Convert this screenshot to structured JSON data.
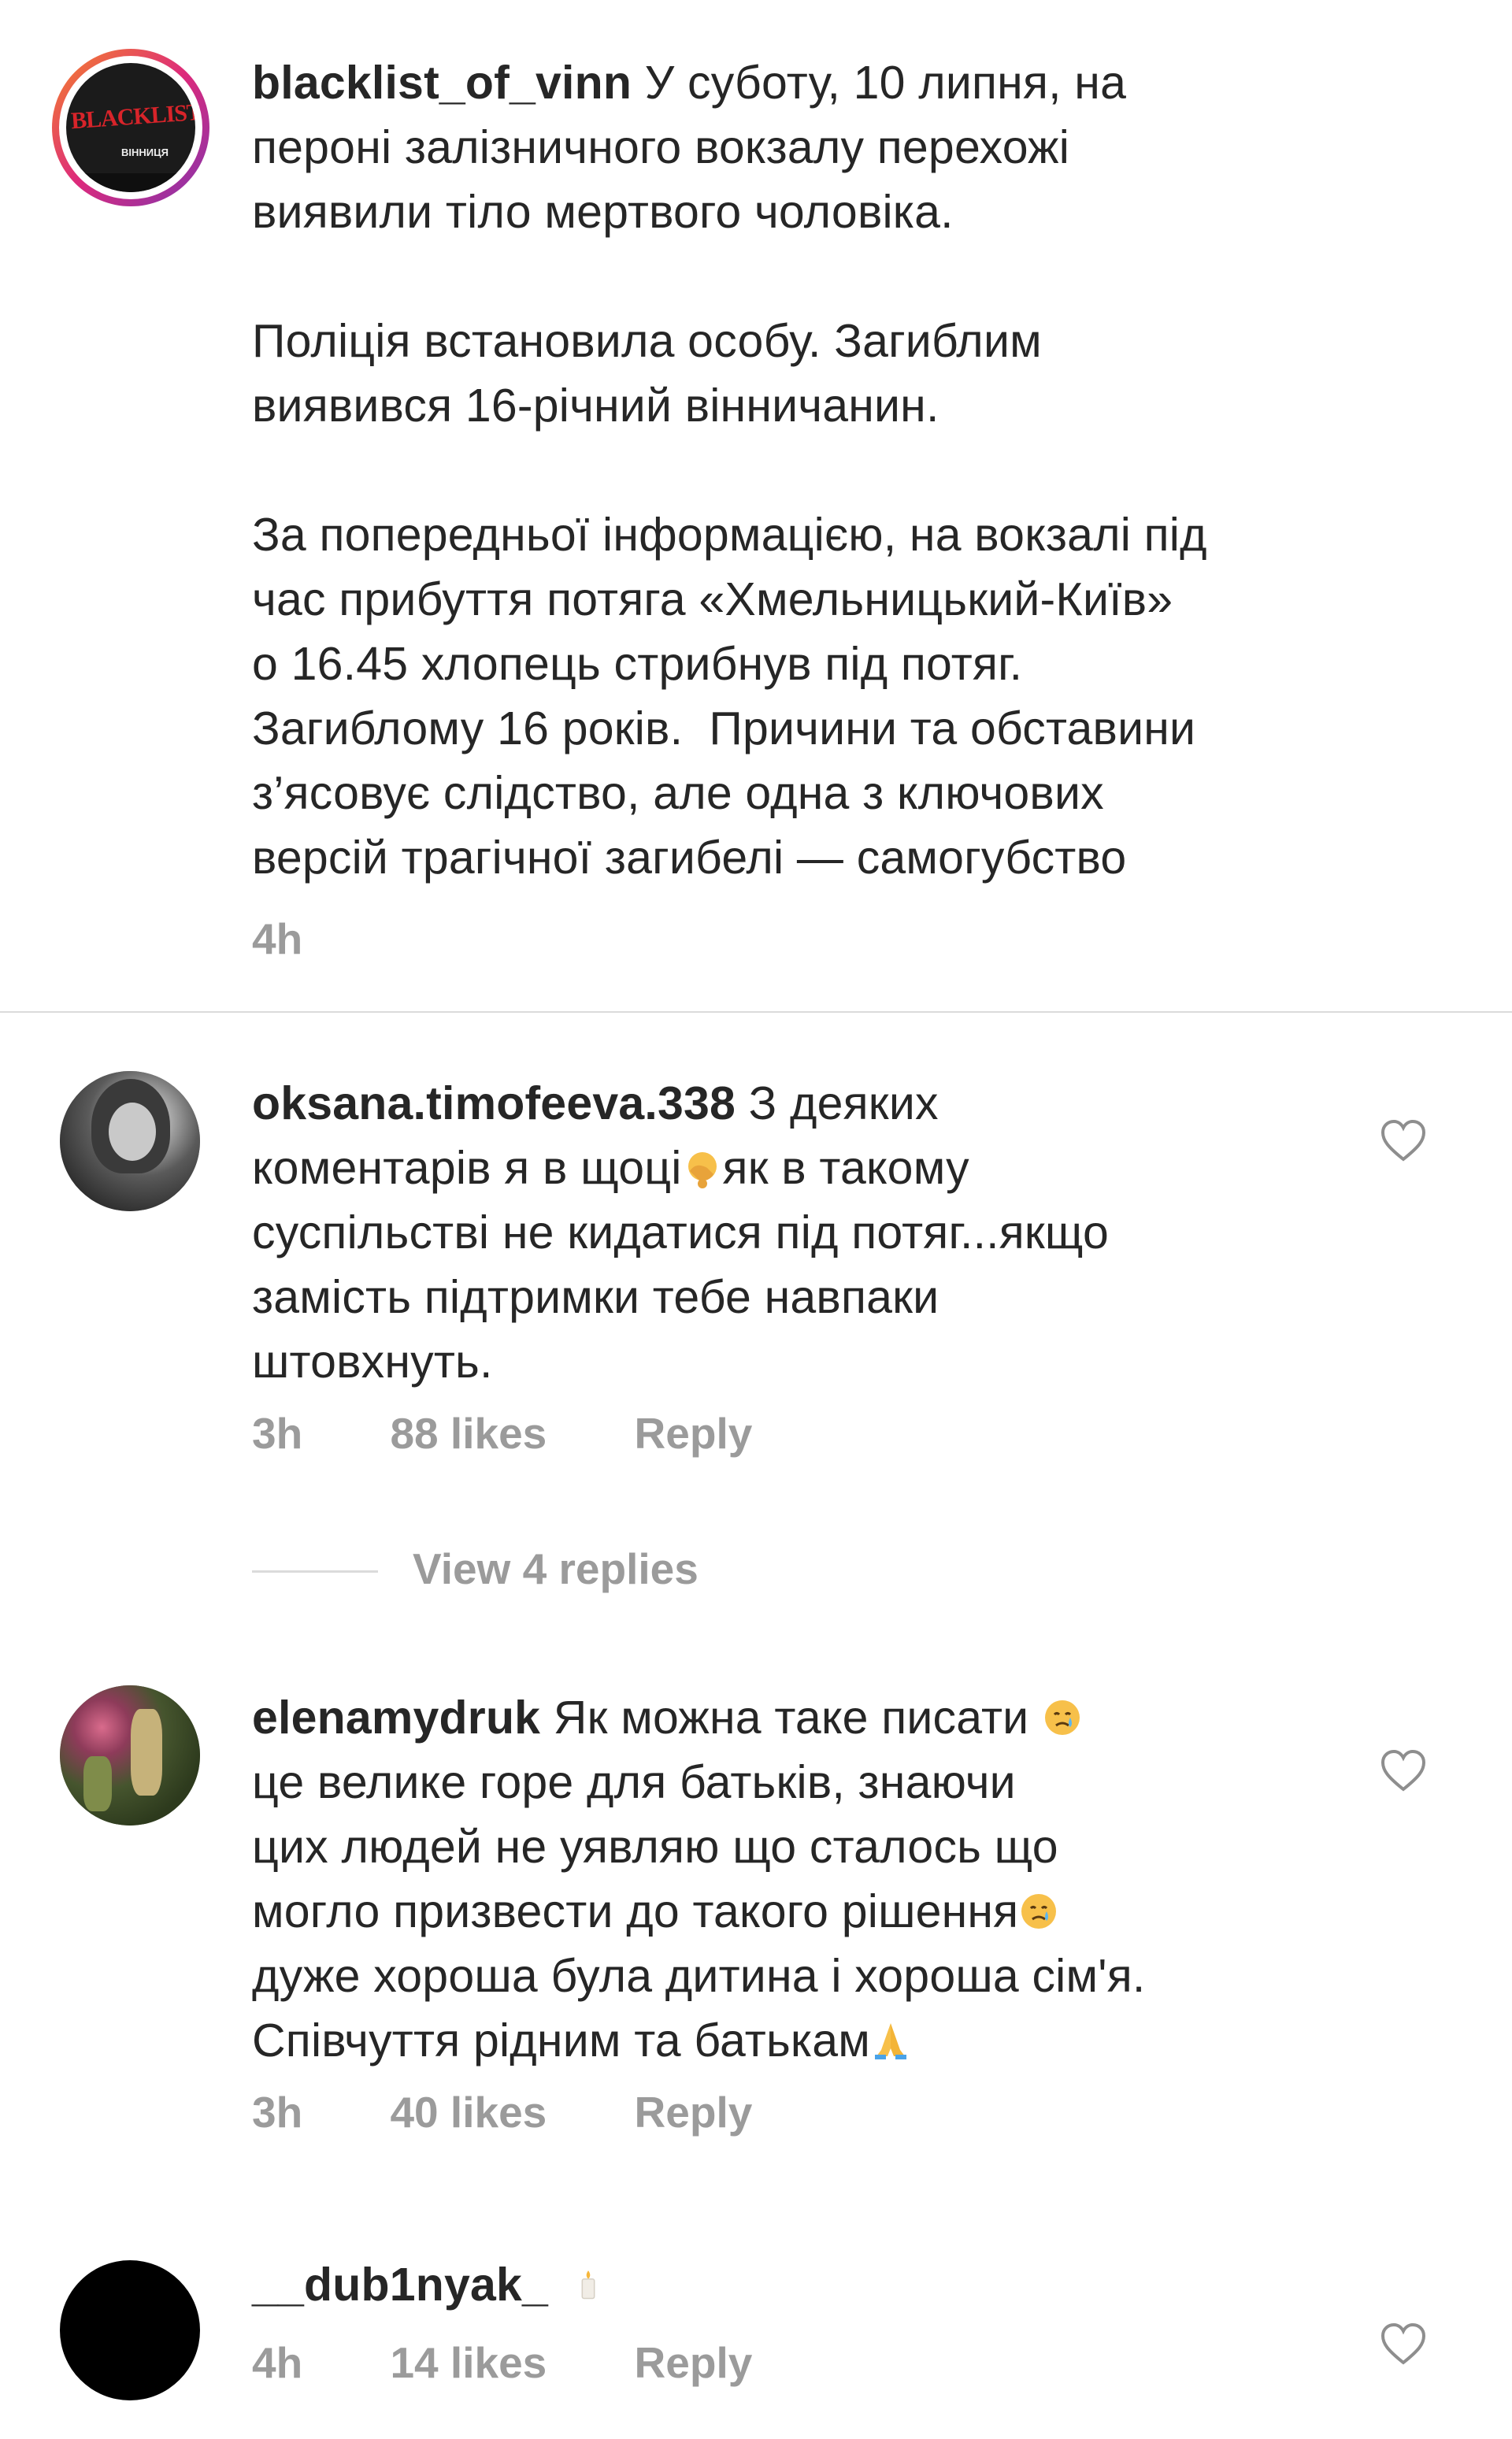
{
  "caption": {
    "username": "blacklist_of_vinn",
    "paragraphs": [
      "У суботу, 10 липня, на\nпероні залізничного вокзалу перехожі\nвиявили тіло мертвого чоловіка.",
      "Поліція встановила особу. Загиблим\nвиявився 16-річний вінничанин.",
      "За попередньої інформацією, на вокзалі під\nчас прибуття потяга «Хмельницький-Київ»\nо 16.45 хлопець стрибнув під потяг.\nЗагиблому 16 років.  Причини та обставини\nз’ясовує слідство, але одна з ключових\nверсій трагічної загибелі — самогубство"
    ],
    "time": "4h",
    "avatar_text": "BLACKLIST",
    "avatar_subtext": "ВІННИЦЯ"
  },
  "comments": [
    {
      "username": "oksana.timofeeva.338",
      "text_before_emoji": "З деяких\nкоментарів я в щоці",
      "text_after_emoji": "як в такому\nсуспільстві не кидатися під потяг...якщо\nзамість підтримки тебе навпаки\nштовхнуть.",
      "time": "3h",
      "likes": "88 likes",
      "reply": "Reply",
      "view_replies": "View 4 replies"
    },
    {
      "username": "elenamydruk",
      "text_line1": "Як можна таке писати",
      "text_line2_5": "це велике горе для батьків, знаючи\nцих людей не уявляю що сталось що\nмогло призвести до такого рішення",
      "text_line6": "дуже хороша була дитина і хороша сім'я.\nСпівчуття рідним та батькам",
      "time": "3h",
      "likes": "40 likes",
      "reply": "Reply"
    },
    {
      "username": "__dub1nyak_",
      "time": "4h",
      "likes": "14 likes",
      "reply": "Reply"
    }
  ],
  "colors": {
    "text": "#262626",
    "meta": "#9b9b9b",
    "divider": "#dbdbdb",
    "story_ring_start": "#f58529",
    "story_ring_end": "#dd2a7b"
  }
}
